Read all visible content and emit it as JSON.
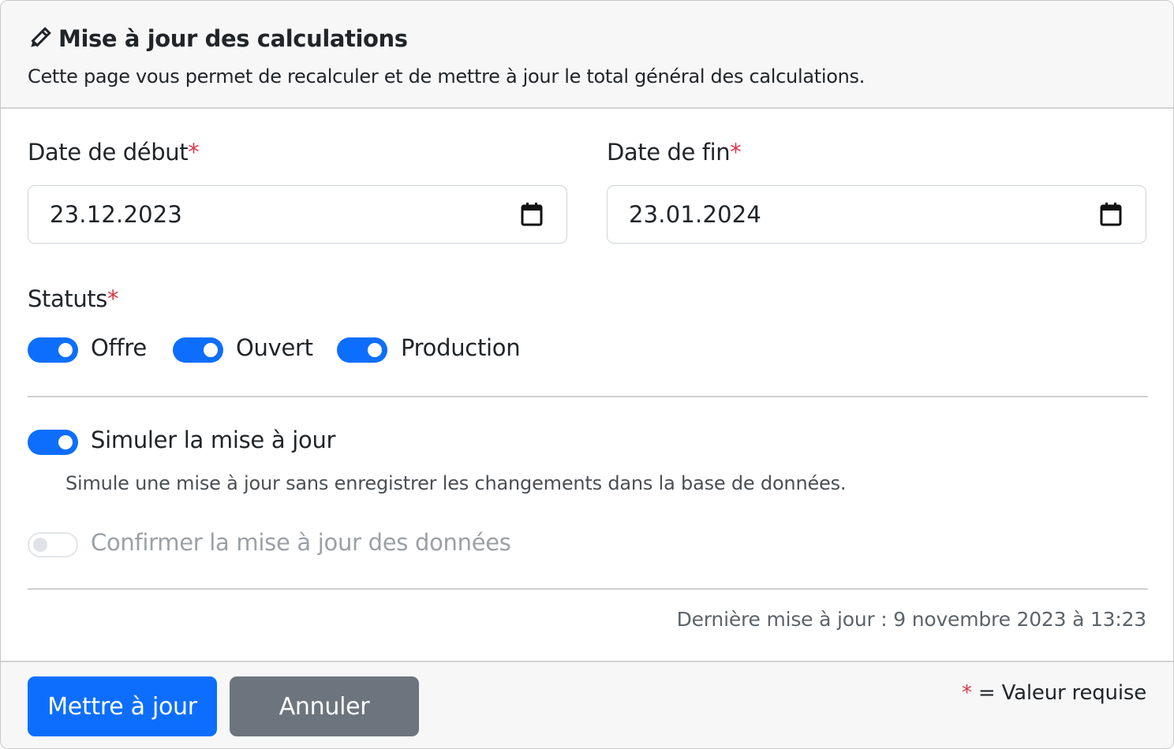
{
  "header": {
    "title": "Mise à jour des calculations",
    "icon": "pencil-icon",
    "subtitle": "Cette page vous permet de recalculer et de mettre à jour le total général des calculations."
  },
  "fields": {
    "start_date": {
      "label": "Date de début",
      "value": "23.12.2023",
      "icon": "calendar-icon"
    },
    "end_date": {
      "label": "Date de fin",
      "value": "23.01.2024",
      "icon": "calendar-icon"
    },
    "required_marker": "*"
  },
  "statuses": {
    "label": "Statuts",
    "items": [
      {
        "label": "Offre",
        "checked": true
      },
      {
        "label": "Ouvert",
        "checked": true
      },
      {
        "label": "Production",
        "checked": true
      }
    ]
  },
  "simulate": {
    "label": "Simuler la mise à jour",
    "checked": true,
    "help": "Simule une mise à jour sans enregistrer les changements dans la base de données."
  },
  "confirm": {
    "label": "Confirmer la mise à jour des données",
    "checked": false,
    "disabled": true
  },
  "last_update": "Dernière mise à jour : 9 novembre 2023 à 13:23",
  "footer": {
    "submit_label": "Mettre à jour",
    "cancel_label": "Annuler",
    "required_note_marker": "*",
    "required_note_text": " = Valeur requise"
  },
  "colors": {
    "primary": "#0d6efd",
    "secondary": "#6c757d",
    "required": "#dc3545"
  }
}
